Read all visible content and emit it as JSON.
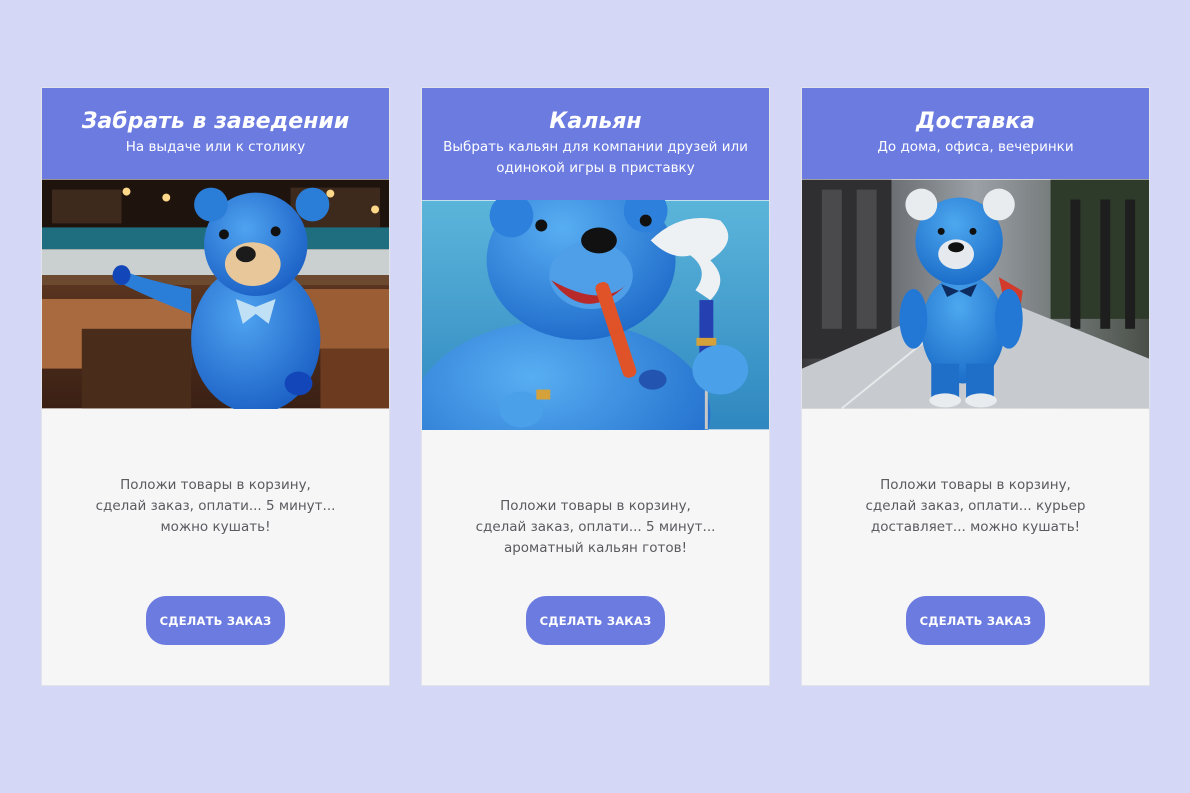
{
  "cards": [
    {
      "title": "Забрать в заведении",
      "subtitle": "На выдаче или к столику",
      "image_icon": "blue-teddy-bear-in-cafe-image",
      "text": "Положи товары в корзину, сделай заказ, оплати... 5 минут... можно кушать!",
      "button_label": "СДЕЛАТЬ ЗАКАЗ"
    },
    {
      "title": "Кальян",
      "subtitle": "Выбрать кальян для компании друзей или одинокой игры в приставку",
      "image_icon": "blue-teddy-bear-with-hookah-image",
      "text": "Положи товары в корзину, сделай заказ, оплати... 5 минут... ароматный кальян готов!",
      "button_label": "СДЕЛАТЬ ЗАКАЗ"
    },
    {
      "title": "Доставка",
      "subtitle": "До дома, офиса, вечеринки",
      "image_icon": "blue-teddy-bear-walking-street-image",
      "text": "Положи товары в корзину, сделай заказ, оплати... курьер доставляет... можно кушать!",
      "button_label": "СДЕЛАТЬ ЗАКАЗ"
    }
  ],
  "colors": {
    "page_background": "#d5d7f6",
    "accent": "#6b7be0",
    "card_background": "#f6f6f7",
    "body_text": "#5a5a5f"
  }
}
